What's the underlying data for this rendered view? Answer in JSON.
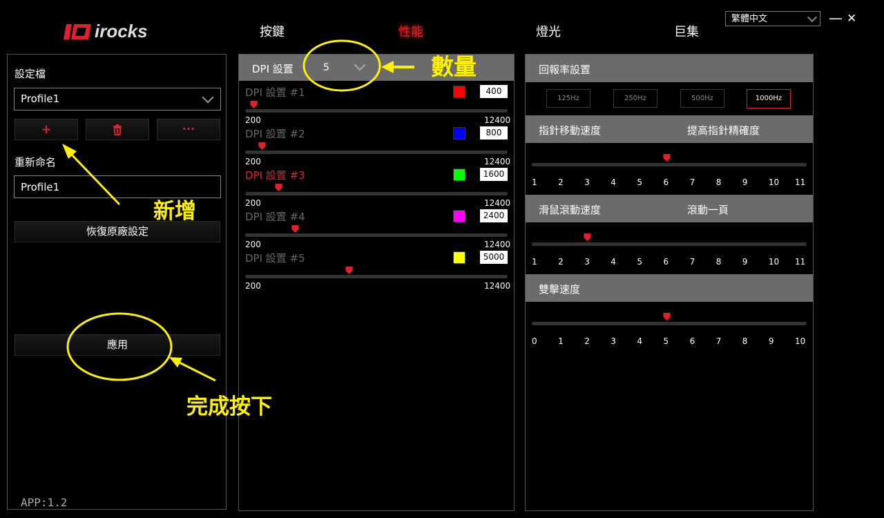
{
  "header": {
    "logo_text": "irocks",
    "tabs": [
      {
        "label": "按鍵"
      },
      {
        "label": "性能"
      },
      {
        "label": "燈光"
      },
      {
        "label": "巨集"
      }
    ],
    "active_tab": "性能",
    "language": "繁體中文",
    "minimize": "—",
    "close": "✕"
  },
  "left": {
    "profile_label": "設定檔",
    "profile_value": "Profile1",
    "add_icon": "+",
    "delete_icon": "trash-icon",
    "more_icon": "···",
    "rename_label": "重新命名",
    "rename_value": "Profile1",
    "reset_button": "恢復原廠設定",
    "apply_button": "應用",
    "version": "APP:1.2"
  },
  "dpi": {
    "header_label": "DPI 設置",
    "count": "5",
    "min": "200",
    "max": "12400",
    "rows": [
      {
        "label": "DPI 設置 #1",
        "value": "400",
        "color": "#ff0000",
        "active": false
      },
      {
        "label": "DPI 設置 #2",
        "value": "800",
        "color": "#0000ff",
        "active": false
      },
      {
        "label": "DPI 設置 #3",
        "value": "1600",
        "color": "#00ff00",
        "active": true
      },
      {
        "label": "DPI 設置 #4",
        "value": "2400",
        "color": "#ff00ff",
        "active": false
      },
      {
        "label": "DPI 設置 #5",
        "value": "5000",
        "color": "#ffff00",
        "active": false
      }
    ]
  },
  "right": {
    "report_rate_label": "回報率設置",
    "rates": [
      "125Hz",
      "250Hz",
      "500Hz",
      "1000Hz"
    ],
    "active_rate": "1000Hz",
    "pointer_speed_label": "指針移動速度",
    "precision_label": "提高指針精確度",
    "pointer_speed_value": 6,
    "pointer_ticks": [
      "1",
      "2",
      "3",
      "4",
      "5",
      "6",
      "7",
      "8",
      "9",
      "10",
      "11"
    ],
    "scroll_speed_label": "滑鼠滾動速度",
    "scroll_page_label": "滾動一頁",
    "scroll_speed_value": 3,
    "scroll_ticks": [
      "1",
      "2",
      "3",
      "4",
      "5",
      "6",
      "7",
      "8",
      "9",
      "10",
      "11"
    ],
    "double_click_label": "雙擊速度",
    "double_click_value": 5,
    "double_click_ticks": [
      "0",
      "1",
      "2",
      "3",
      "4",
      "5",
      "6",
      "7",
      "8",
      "9",
      "10"
    ]
  },
  "annotations": {
    "count_note": "數量",
    "add_note": "新增",
    "apply_note": "完成按下"
  },
  "colors": {
    "accent": "#e0202a",
    "annotation": "#fff200",
    "panel_header": "#6b6b6b"
  }
}
